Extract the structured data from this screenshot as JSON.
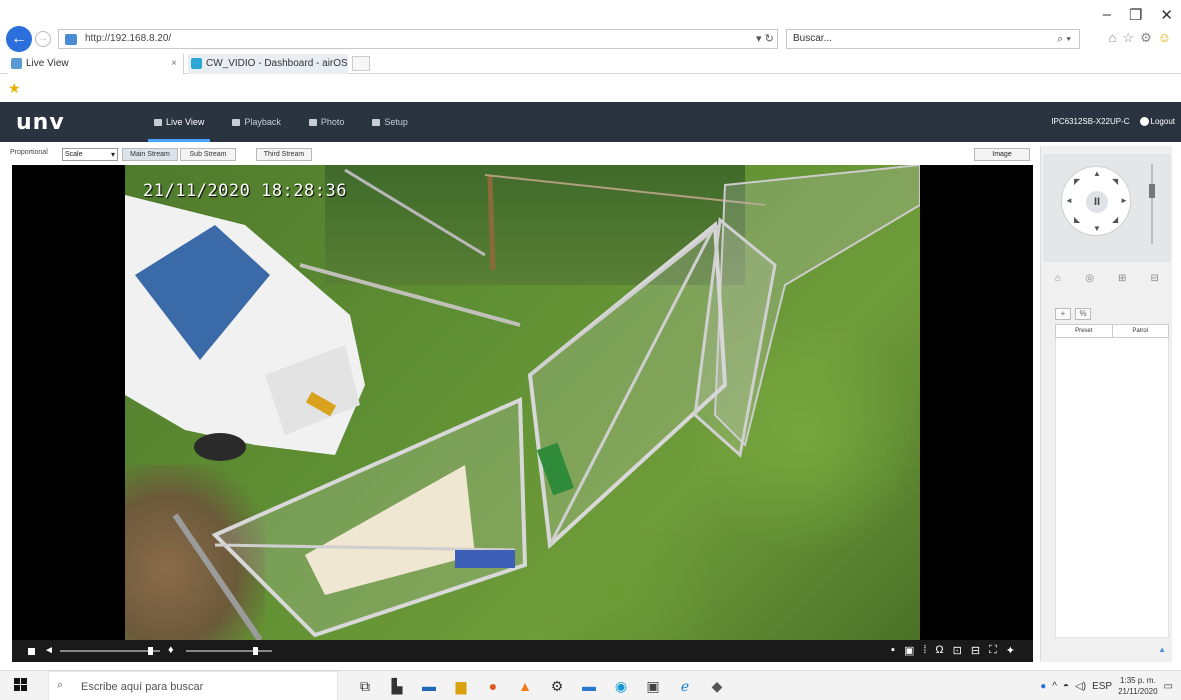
{
  "browser": {
    "url": "http://192.168.8.20/",
    "search_placeholder": "Buscar...",
    "tabs": [
      {
        "label": "Live View"
      },
      {
        "label": "CW_VIDIO - Dashboard - airOS"
      }
    ]
  },
  "app": {
    "logo": "unv",
    "nav": [
      {
        "label": "Live View"
      },
      {
        "label": "Playback"
      },
      {
        "label": "Photo"
      },
      {
        "label": "Setup"
      }
    ],
    "device_name": "IPC6312SB-X22UP-C",
    "logout_label": "Logout"
  },
  "view_toolbar": {
    "proportion_label": "Proportional",
    "proportion_value": "Scale",
    "streams": [
      "Main Stream",
      "Sub Stream",
      "Third Stream"
    ],
    "image_button": "Image"
  },
  "video": {
    "osd_timestamp": "21/11/2020 18:28:36",
    "volume": 0.9,
    "mic_volume": 0.8
  },
  "ptz": {
    "center_label": "II",
    "tab_labels": [
      "+",
      "%"
    ],
    "list_headers": [
      "Preset",
      "Patrol"
    ]
  },
  "taskbar": {
    "search_placeholder": "Escribe aquí para buscar",
    "lang": "ESP",
    "time": "1:35 p. m.",
    "date": "21/11/2020"
  },
  "colors": {
    "header_bg": "#2a3340",
    "accent": "#4aa3ff",
    "taskbar_bg": "#f3f3f3"
  }
}
